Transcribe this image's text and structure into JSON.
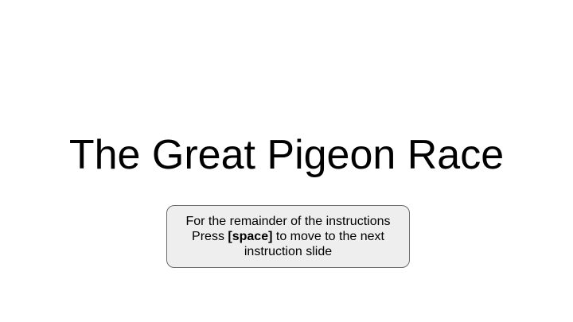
{
  "slide": {
    "title": "The Great Pigeon Race",
    "note": {
      "line1": "For the remainder of the instructions",
      "line2_prefix": "Press ",
      "line2_key": "[space]",
      "line2_suffix": " to move to the next",
      "line3": "instruction slide"
    }
  },
  "colors": {
    "background": "#ffffff",
    "text": "#000000",
    "note_box_fill": "#eeeeee",
    "note_box_border": "#6b6b6b"
  }
}
